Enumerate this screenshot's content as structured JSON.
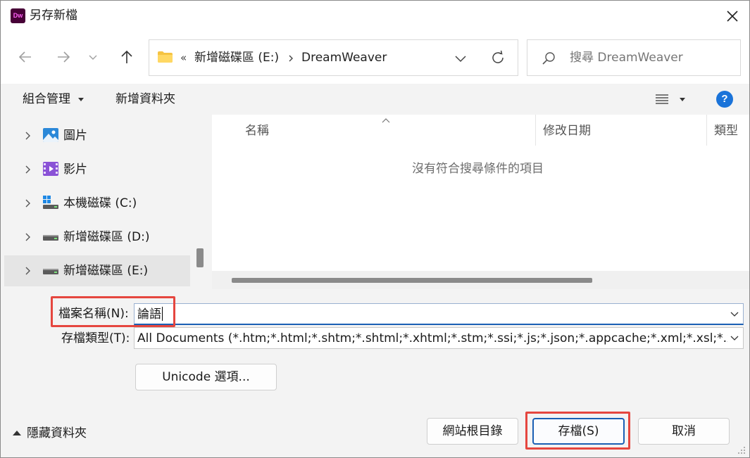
{
  "window": {
    "title": "另存新檔",
    "app_badge": "Dw"
  },
  "address": {
    "overflow": "«",
    "crumbs": [
      "新增磁碟區 (E:)",
      "DreamWeaver"
    ]
  },
  "search": {
    "placeholder": "搜尋 DreamWeaver"
  },
  "toolbar": {
    "organize": "組合管理",
    "new_folder": "新增資料夾",
    "help": "?"
  },
  "nav": {
    "items": [
      {
        "label": "圖片",
        "icon": "pictures-icon"
      },
      {
        "label": "影片",
        "icon": "videos-icon"
      },
      {
        "label": "本機磁碟 (C:)",
        "icon": "windows-drive-icon"
      },
      {
        "label": "新增磁碟區 (D:)",
        "icon": "drive-icon"
      },
      {
        "label": "新增磁碟區 (E:)",
        "icon": "drive-icon",
        "selected": true
      }
    ]
  },
  "files": {
    "columns": [
      "名稱",
      "修改日期",
      "類型"
    ],
    "empty_message": "沒有符合搜尋條件的項目"
  },
  "form": {
    "filename_label": "檔案名稱(N):",
    "filename_value": "論語",
    "filetype_label": "存檔類型(T):",
    "filetype_value": "All Documents (*.htm;*.html;*.shtm;*.shtml;*.xhtml;*.stm;*.ssi;*.js;*.json;*.appcache;*.xml;*.xsl;*.xsd;*.",
    "unicode_button": "Unicode 選項..."
  },
  "footer": {
    "hide_folders": "隱藏資料夾",
    "site_root": "網站根目錄",
    "save": "存檔(S)",
    "cancel": "取消"
  },
  "colors": {
    "accent": "#1a5fb4",
    "highlight": "#e5463f",
    "help_blue": "#1a73d9"
  }
}
